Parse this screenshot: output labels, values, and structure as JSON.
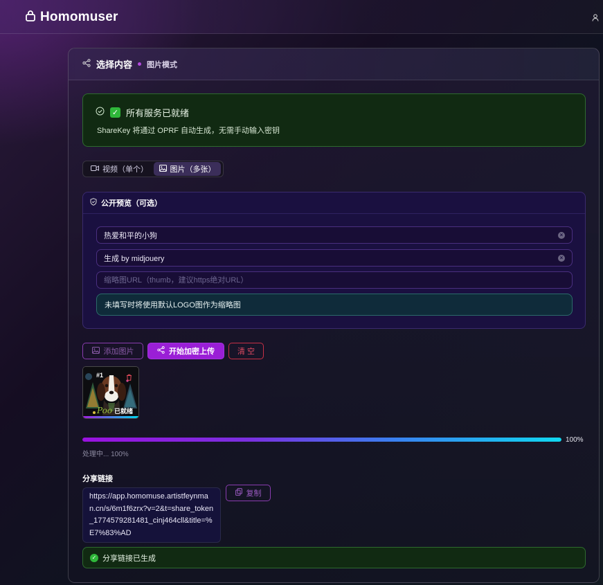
{
  "app": {
    "name": "Homomuser"
  },
  "card": {
    "title": "选择内容",
    "mode": "图片模式"
  },
  "status": {
    "check_glyph": "✓",
    "title": "所有服务已就绪",
    "description": "ShareKey 将通过 OPRF 自动生成，无需手动输入密钥"
  },
  "tabs": [
    {
      "label": "视频（单个）",
      "icon": "video-icon",
      "active": false
    },
    {
      "label": "图片（多张）",
      "icon": "image-icon",
      "active": true
    }
  ],
  "preview": {
    "title": "公开预览（可选）",
    "title_value": "热爱和平的小狗",
    "subtitle_value": "生成 by midjouery",
    "thumb_placeholder": "缩略图URL（thumb，建议https绝对URL）",
    "clear_glyph": "×",
    "note": "未填写时将使用默认LOGO图作为缩略图"
  },
  "actions": {
    "add_images": "添加图片",
    "start_upload": "开始加密上传",
    "clear": "清 空"
  },
  "images": [
    {
      "index_label": "#1",
      "status": "已就绪",
      "signature": "Poo"
    }
  ],
  "progress": {
    "percent": 100,
    "percent_label": "100%",
    "status_text": "处理中... 100%"
  },
  "share": {
    "label": "分享链接",
    "link": "https://app.homomuse.artistfeynman.cn/s/6m1f6zrx?v=2&t=share_token_1774579281481_cinj464cll&title=%E7%83%AD",
    "copy_label": "复制",
    "success_glyph": "✓",
    "success_text": "分享链接已生成"
  },
  "colors": {
    "accent": "#9a1fd6",
    "success": "#2fb83a",
    "danger": "#e04a62",
    "progress_end": "#10d8f0"
  }
}
